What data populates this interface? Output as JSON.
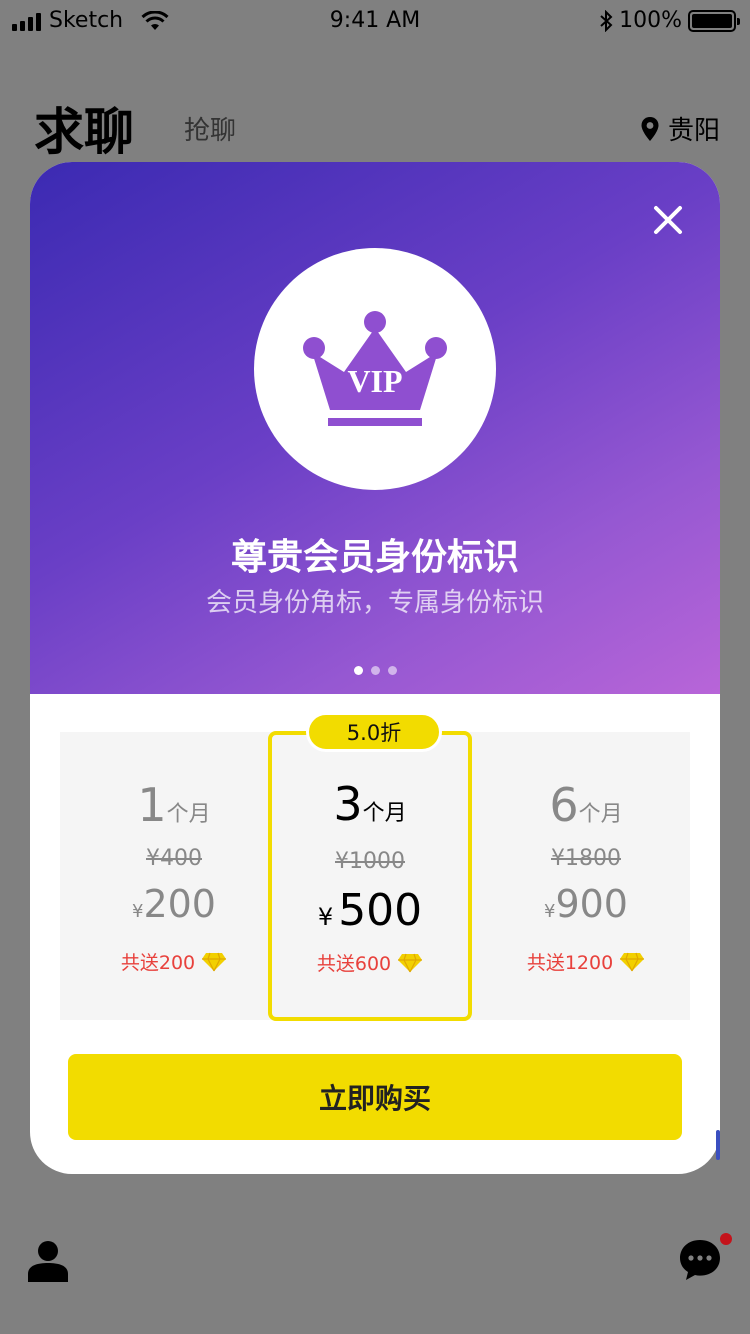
{
  "status_bar": {
    "carrier": "Sketch",
    "time": "9:41 AM",
    "battery": "100%"
  },
  "header": {
    "title": "求聊",
    "tab": "抢聊",
    "city": "贵阳"
  },
  "modal": {
    "badge_text": "VIP",
    "benefit_title": "尊贵会员身份标识",
    "benefit_subtitle": "会员身份角标，专属身份标识",
    "carousel": {
      "count": 3,
      "active_index": 0
    },
    "discount_badge": "5.0折",
    "plans": [
      {
        "num": "1",
        "unit": "个月",
        "original": "¥400",
        "currency": "¥",
        "price": "200",
        "gift": "共送200",
        "selected": false
      },
      {
        "num": "3",
        "unit": "个月",
        "original": "¥1000",
        "currency": "¥",
        "price": "500",
        "gift": "共送600",
        "selected": true
      },
      {
        "num": "6",
        "unit": "个月",
        "original": "¥1800",
        "currency": "¥",
        "price": "900",
        "gift": "共送1200",
        "selected": false
      }
    ],
    "buy_label": "立即购买"
  },
  "colors": {
    "accent_yellow": "#f2dc00",
    "gift_red": "#e8413c",
    "gradient_start": "#3b2ab2",
    "gradient_end": "#b865d8",
    "crown_purple": "#8f4fd0"
  },
  "icons": [
    "close-icon",
    "crown-icon",
    "location-pin-icon",
    "diamond-icon",
    "profile-icon",
    "chat-icon"
  ]
}
